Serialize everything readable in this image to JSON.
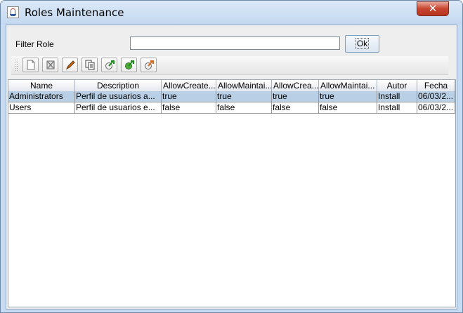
{
  "window": {
    "title": "Roles Maintenance",
    "close_label": "✕"
  },
  "filter": {
    "label": "Filter Role",
    "value": "",
    "ok_label": "Ok"
  },
  "toolbar": {
    "buttons": [
      {
        "icon": "new-document-icon"
      },
      {
        "icon": "delete-icon"
      },
      {
        "icon": "edit-pencil-icon"
      },
      {
        "icon": "copy-icon"
      },
      {
        "icon": "assign-green-icon"
      },
      {
        "icon": "assign-all-green-icon"
      },
      {
        "icon": "export-orange-icon"
      }
    ]
  },
  "table": {
    "columns": [
      "Name",
      "Description",
      "AllowCreate...",
      "AllowMaintai...",
      "AllowCrea...",
      "AllowMaintai...",
      "Autor",
      "Fecha"
    ],
    "rows": [
      [
        "Administrators",
        "Perfil de usuarios a...",
        "true",
        "true",
        "true",
        "true",
        "Install",
        "06/03/2..."
      ],
      [
        "Users",
        "Perfil de usuarios e...",
        "false",
        "false",
        "false",
        "false",
        "Install",
        "06/03/2..."
      ]
    ],
    "selected_row": 0
  },
  "colors": {
    "selection": "#b8cfe5",
    "titlebar": "#c3d8f0",
    "close": "#c7452f"
  }
}
